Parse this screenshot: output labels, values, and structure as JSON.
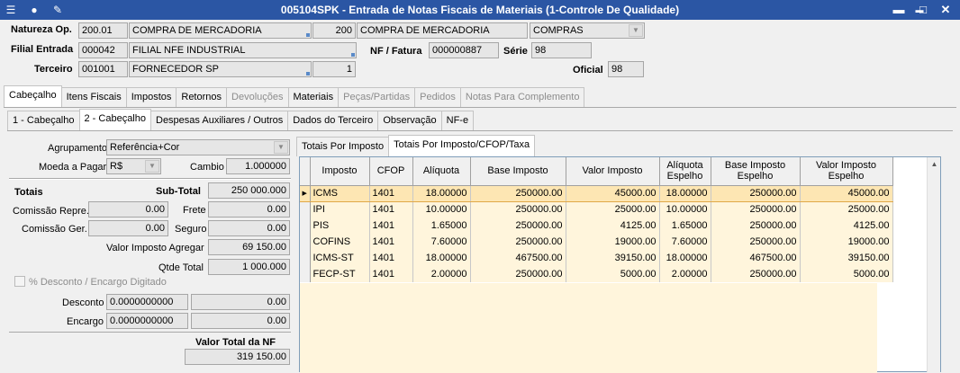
{
  "window": {
    "title": "005104SPK - Entrada de Notas Fiscais de Materiais (1-Controle De Qualidade)",
    "icons": [
      "window-menu-icon",
      "traffic-light-icon",
      "wrench-icon"
    ],
    "buttons": {
      "minimize": "▬",
      "restore": "▬",
      "maximize": "□",
      "close": "✕"
    }
  },
  "header": {
    "natureza_label": "Natureza Op.",
    "natureza_code": "200.01",
    "natureza_desc": "COMPRA DE MERCADORIA",
    "natureza_num": "200",
    "natureza_desc2": "COMPRA DE MERCADORIA",
    "natureza_type": "COMPRAS",
    "filial_label": "Filial Entrada",
    "filial_code": "000042",
    "filial_desc": "FILIAL NFE INDUSTRIAL",
    "nf_label": "NF / Fatura",
    "nf_value": "000000887",
    "serie_label": "Série",
    "serie_value": "98",
    "terceiro_label": "Terceiro",
    "terceiro_code": "001001",
    "terceiro_desc": "FORNECEDOR SP",
    "terceiro_num": "1",
    "oficial_label": "Oficial",
    "oficial_value": "98"
  },
  "main_tabs": [
    {
      "label": "Cabeçalho",
      "state": "active"
    },
    {
      "label": "Itens Fiscais",
      "state": "normal"
    },
    {
      "label": "Impostos",
      "state": "normal"
    },
    {
      "label": "Retornos",
      "state": "normal"
    },
    {
      "label": "Devoluções",
      "state": "disabled"
    },
    {
      "label": "Materiais",
      "state": "normal"
    },
    {
      "label": "Peças/Partidas",
      "state": "disabled"
    },
    {
      "label": "Pedidos",
      "state": "disabled"
    },
    {
      "label": "Notas Para Complemento",
      "state": "disabled"
    }
  ],
  "sub_tabs": [
    {
      "label": "1 - Cabeçalho",
      "state": "normal"
    },
    {
      "label": "2 - Cabeçalho",
      "state": "active"
    },
    {
      "label": "Despesas Auxiliares / Outros",
      "state": "normal"
    },
    {
      "label": "Dados do Terceiro",
      "state": "normal"
    },
    {
      "label": "Observação",
      "state": "normal"
    },
    {
      "label": "NF-e",
      "state": "normal"
    }
  ],
  "left": {
    "agrupamento_label": "Agrupamento",
    "agrupamento_value": "Referência+Cor",
    "moeda_label": "Moeda a Pagar",
    "moeda_value": "R$",
    "cambio_label": "Cambio",
    "cambio_value": "1.000000",
    "totais_label": "Totais",
    "subtotal_label": "Sub-Total",
    "subtotal_value": "250 000.000",
    "comissao_repre_label": "Comissão Repre.",
    "comissao_repre_value": "0.00",
    "frete_label": "Frete",
    "frete_value": "0.00",
    "comissao_ger_label": "Comissão Ger.",
    "comissao_ger_value": "0.00",
    "seguro_label": "Seguro",
    "seguro_value": "0.00",
    "valor_imposto_agregar_label": "Valor Imposto Agregar",
    "valor_imposto_agregar_value": "69 150.00",
    "qtde_total_label": "Qtde Total",
    "qtde_total_value": "1 000.000",
    "desconto_encargo_label": "% Desconto / Encargo Digitado",
    "desconto_label": "Desconto",
    "desconto_pct": "0.0000000000",
    "desconto_value": "0.00",
    "encargo_label": "Encargo",
    "encargo_pct": "0.0000000000",
    "encargo_value": "0.00",
    "valor_total_label": "Valor Total da NF",
    "valor_total_value": "319 150.00"
  },
  "grid_tabs": [
    {
      "label": "Totais Por Imposto",
      "state": "normal"
    },
    {
      "label": "Totais Por Imposto/CFOP/Taxa",
      "state": "active"
    }
  ],
  "grid": {
    "columns": [
      "Imposto",
      "CFOP",
      "Alíquota",
      "Base Imposto",
      "Valor Imposto",
      "Alíquota Espelho",
      "Base Imposto Espelho",
      "Valor Imposto Espelho"
    ],
    "rows": [
      [
        "ICMS",
        "1401",
        "18.00000",
        "250000.00",
        "45000.00",
        "18.00000",
        "250000.00",
        "45000.00"
      ],
      [
        "IPI",
        "1401",
        "10.00000",
        "250000.00",
        "25000.00",
        "10.00000",
        "250000.00",
        "25000.00"
      ],
      [
        "PIS",
        "1401",
        "1.65000",
        "250000.00",
        "4125.00",
        "1.65000",
        "250000.00",
        "4125.00"
      ],
      [
        "COFINS",
        "1401",
        "7.60000",
        "250000.00",
        "19000.00",
        "7.60000",
        "250000.00",
        "19000.00"
      ],
      [
        "ICMS-ST",
        "1401",
        "18.00000",
        "467500.00",
        "39150.00",
        "18.00000",
        "467500.00",
        "39150.00"
      ],
      [
        "FECP-ST",
        "1401",
        "2.00000",
        "250000.00",
        "5000.00",
        "2.00000",
        "250000.00",
        "5000.00"
      ]
    ],
    "selected_row": 0
  },
  "colors": {
    "titlebar": "#2b56a4",
    "selected_row": "#fde6b3",
    "grid_row_bg": "#fff5dc"
  }
}
